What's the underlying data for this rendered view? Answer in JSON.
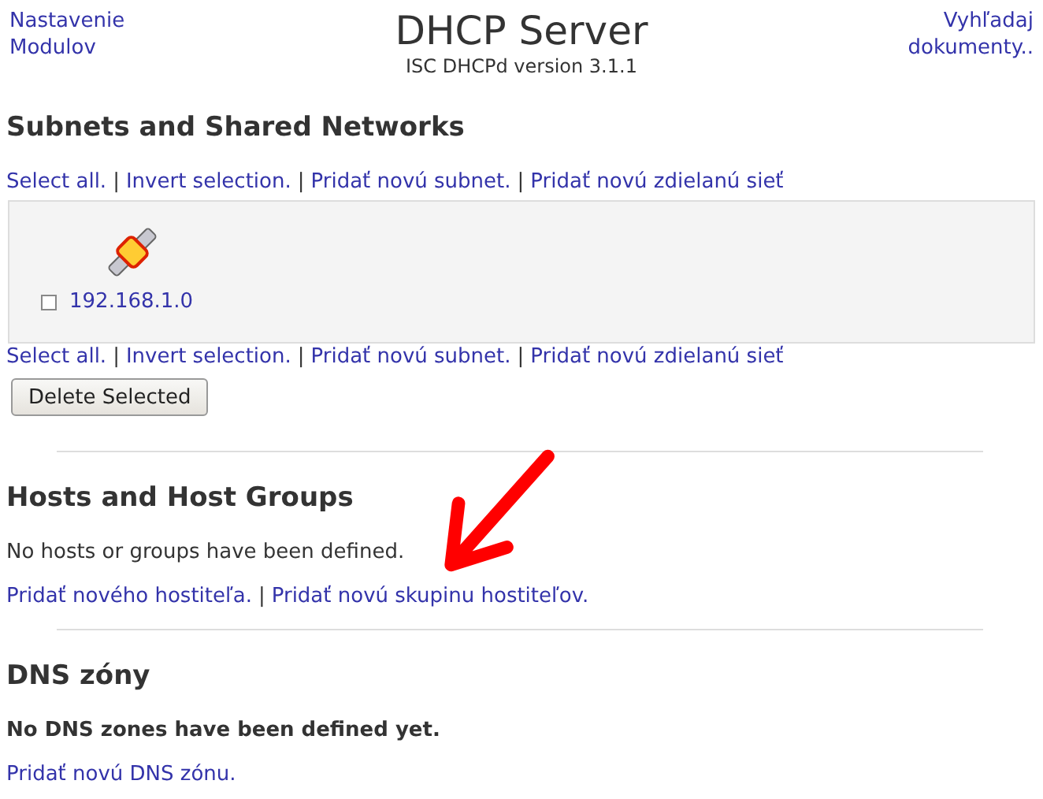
{
  "header": {
    "left_link": "Nastavenie Modulov",
    "title": "DHCP Server",
    "subtitle": "ISC DHCPd version 3.1.1",
    "right_link": "Vyhľadaj dokumenty.."
  },
  "subnets": {
    "heading": "Subnets and Shared Networks",
    "links_top": {
      "separator": "|",
      "items": [
        "Select all.",
        "Invert selection.",
        "Pridať novú subnet.",
        "Pridať novú zdielanú sieť"
      ]
    },
    "items": [
      {
        "label": "192.168.1.0",
        "checked": false
      }
    ],
    "links_bottom": {
      "separator": "|",
      "items": [
        "Select all.",
        "Invert selection.",
        "Pridať novú subnet.",
        "Pridať novú zdielanú sieť"
      ]
    },
    "button": "Delete Selected"
  },
  "hosts": {
    "heading": "Hosts and Host Groups",
    "message": "No hosts or groups have been defined.",
    "links": {
      "separator": "|",
      "items": [
        "Pridať nového hostiteľa.",
        "Pridať novú skupinu hostiteľov."
      ]
    }
  },
  "dns": {
    "heading": "DNS zóny",
    "message": "No DNS zones have been defined yet.",
    "links": {
      "items": [
        "Pridať novú DNS zónu."
      ]
    }
  }
}
